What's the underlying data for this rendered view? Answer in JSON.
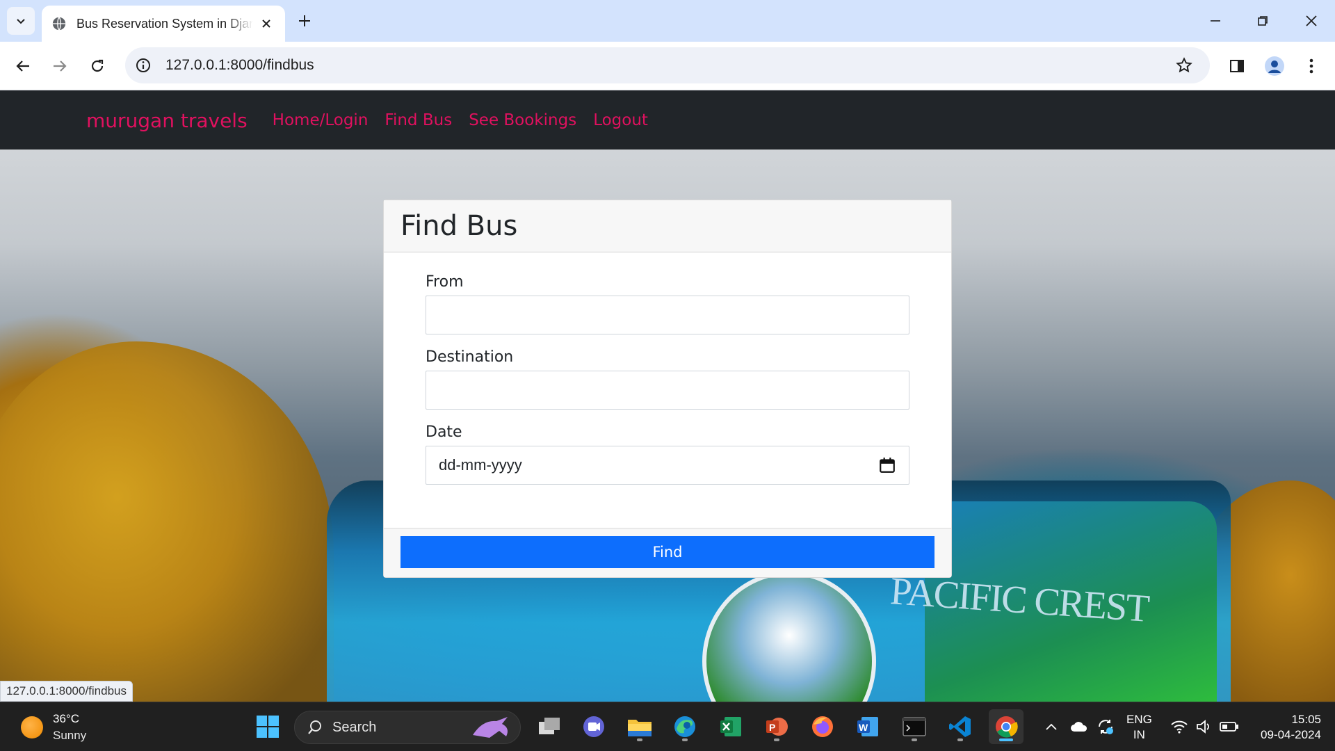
{
  "browser": {
    "tab_title": "Bus Reservation System in Django",
    "url": "127.0.0.1:8000/findbus",
    "status_url": "127.0.0.1:8000/findbus"
  },
  "navbar": {
    "brand": "murugan travels",
    "links": [
      "Home/Login",
      "Find Bus",
      "See Bookings",
      "Logout"
    ],
    "link_color": "#e0115f"
  },
  "form": {
    "title": "Find Bus",
    "from_label": "From",
    "from_value": "",
    "destination_label": "Destination",
    "destination_value": "",
    "date_label": "Date",
    "date_placeholder": "dd-mm-yyyy",
    "submit_label": "Find",
    "submit_color": "#0d6efd"
  },
  "background": {
    "bus_text": "PACIFIC CREST"
  },
  "taskbar": {
    "weather_temp": "36°C",
    "weather_cond": "Sunny",
    "search_placeholder": "Search",
    "lang_top": "ENG",
    "lang_bottom": "IN",
    "time": "15:05",
    "date": "09-04-2024",
    "apps": [
      "task-view-icon",
      "teams-icon",
      "file-explorer-icon",
      "edge-icon",
      "excel-icon",
      "powerpoint-icon",
      "firefox-icon",
      "word-icon",
      "terminal-icon",
      "vscode-icon",
      "chrome-icon"
    ]
  }
}
